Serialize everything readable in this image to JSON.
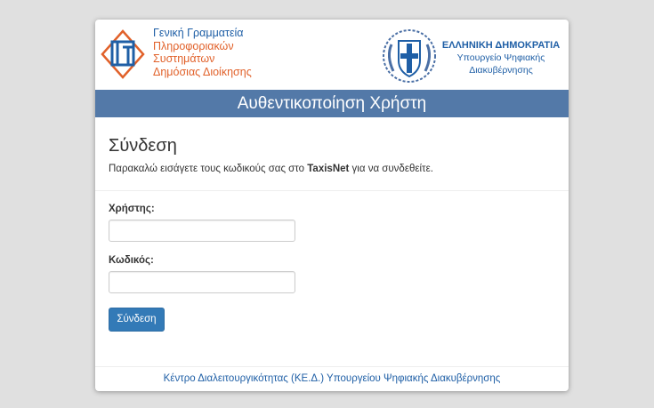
{
  "header": {
    "gsis_lines": [
      "Γενική Γραμματεία",
      "Πληροφοριακών",
      "Συστημάτων",
      "Δημόσιας Διοίκησης"
    ],
    "gov_title": "ΕΛΛΗΝΙΚΗ ΔΗΜΟΚΡΑΤΙΑ",
    "gov_lines": [
      "Υπουργείο Ψηφιακής",
      "Διακυβέρνησης"
    ],
    "left_logo_icon": "gsis-logo-icon",
    "right_logo_icon": "greek-emblem-icon"
  },
  "banner": {
    "title": "Αυθεντικοποίηση Χρήστη"
  },
  "form": {
    "heading": "Σύνδεση",
    "instructions_pre": "Παρακαλώ εισάγετε τους κωδικούς σας στο ",
    "instructions_bold": "TaxisNet",
    "instructions_post": " για να συνδεθείτε.",
    "username_label": "Χρήστης:",
    "username_value": "",
    "password_label": "Κωδικός:",
    "password_value": "",
    "submit_label": "Σύνδεση"
  },
  "footer": {
    "link_text": "Κέντρο Διαλειτουργικότητας (ΚΕ.Δ.) Υπουργείου Ψηφιακής Διακυβέρνησης"
  },
  "colors": {
    "page_background": "#e0e0e0",
    "banner": "#5379a8",
    "primary_button": "#337ab7",
    "gsis_orange": "#e1612a",
    "gov_blue": "#1f5fa6"
  }
}
